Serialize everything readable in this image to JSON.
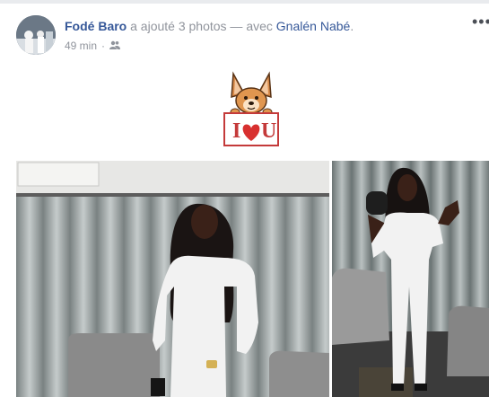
{
  "post": {
    "author": "Fodé Baro",
    "action": "a ajouté 3 photos — avec",
    "tagged": "Gnalén Nabé",
    "period": ".",
    "time": "49 min",
    "separator": "·",
    "audience_icon": "friends-icon",
    "menu_icon": "more-options-icon",
    "menu_glyph": "•••"
  },
  "sticker": {
    "name": "dog-holding-i-love-u-sign",
    "text_i": "I",
    "text_u": "U"
  },
  "photos": [
    {
      "name": "woman-in-white-outfit-standing-by-curtain"
    },
    {
      "name": "woman-in-white-outfit-posing-with-hat"
    }
  ],
  "colors": {
    "link": "#365899",
    "meta": "#90949c",
    "curtain": "#9aa0a0",
    "outfit": "#f2f2f2"
  }
}
